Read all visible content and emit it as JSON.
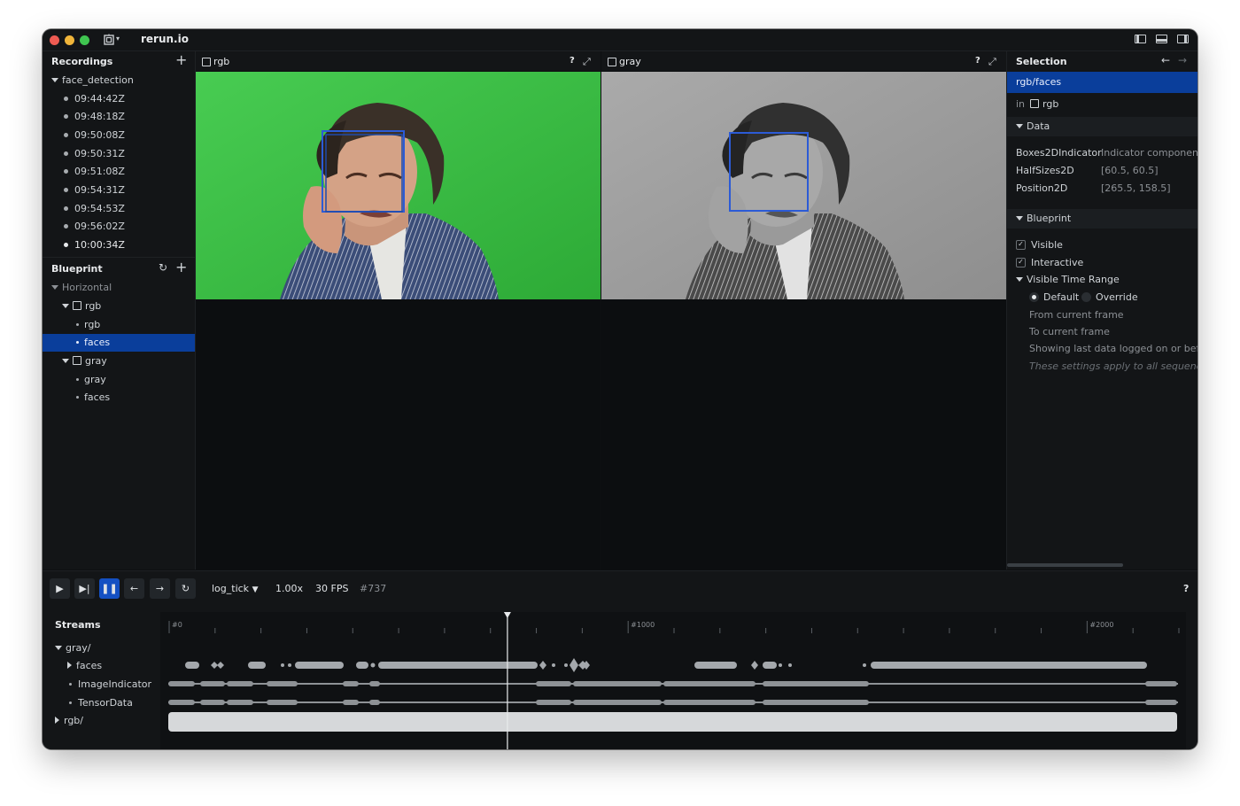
{
  "window": {
    "title": "rerun.io",
    "traffic_colors": [
      "#ee5b52",
      "#f0b53a",
      "#3fc550"
    ]
  },
  "recordings": {
    "header": "Recordings",
    "group": "face_detection",
    "items": [
      "09:44:42Z",
      "09:48:18Z",
      "09:50:08Z",
      "09:50:31Z",
      "09:51:08Z",
      "09:54:31Z",
      "09:54:53Z",
      "09:56:02Z",
      "10:00:34Z"
    ]
  },
  "blueprint_tree": {
    "header": "Blueprint",
    "container": "Horizontal",
    "views": [
      {
        "name": "rgb",
        "children": [
          "rgb",
          "faces"
        ]
      },
      {
        "name": "gray",
        "children": [
          "gray",
          "faces"
        ]
      }
    ]
  },
  "viewports": [
    {
      "title": "rgb",
      "help": "?"
    },
    {
      "title": "gray",
      "help": "?"
    }
  ],
  "selection": {
    "header": "Selection",
    "selected_path": "rgb/faces",
    "in_label": "in",
    "in_view": "rgb",
    "data_section": "Data",
    "data": [
      {
        "key": "Boxes2DIndicator",
        "value": "Indicator component f"
      },
      {
        "key": "HalfSizes2D",
        "value": "[60.5, 60.5]"
      },
      {
        "key": "Position2D",
        "value": "[265.5, 158.5]"
      }
    ],
    "blueprint_section": "Blueprint",
    "visible": "Visible",
    "interactive": "Interactive",
    "time_range": "Visible Time Range",
    "radio_default": "Default",
    "radio_override": "Override",
    "from_frame": "From current frame",
    "to_frame": "To current frame",
    "showing": "Showing last data logged on or before",
    "note": "These settings apply to all sequence ti"
  },
  "timeline": {
    "timeline_name": "log_tick",
    "speed": "1.00x",
    "fps": "30 FPS",
    "frame": "#737",
    "help": "?",
    "ticks": [
      "#0",
      "#1000",
      "#2000"
    ],
    "current_tick": 737,
    "max_tick": 2200
  },
  "streams": {
    "header": "Streams",
    "gray": "gray/",
    "faces": "faces",
    "image_indicator": "ImageIndicator",
    "tensor_data": "TensorData",
    "rgb": "rgb/"
  },
  "colors": {
    "selection_blue": "#0a3e9b",
    "active_button": "#1450c2",
    "box_blue": "#2c5bd6",
    "green_screen": "#3fc04a"
  }
}
